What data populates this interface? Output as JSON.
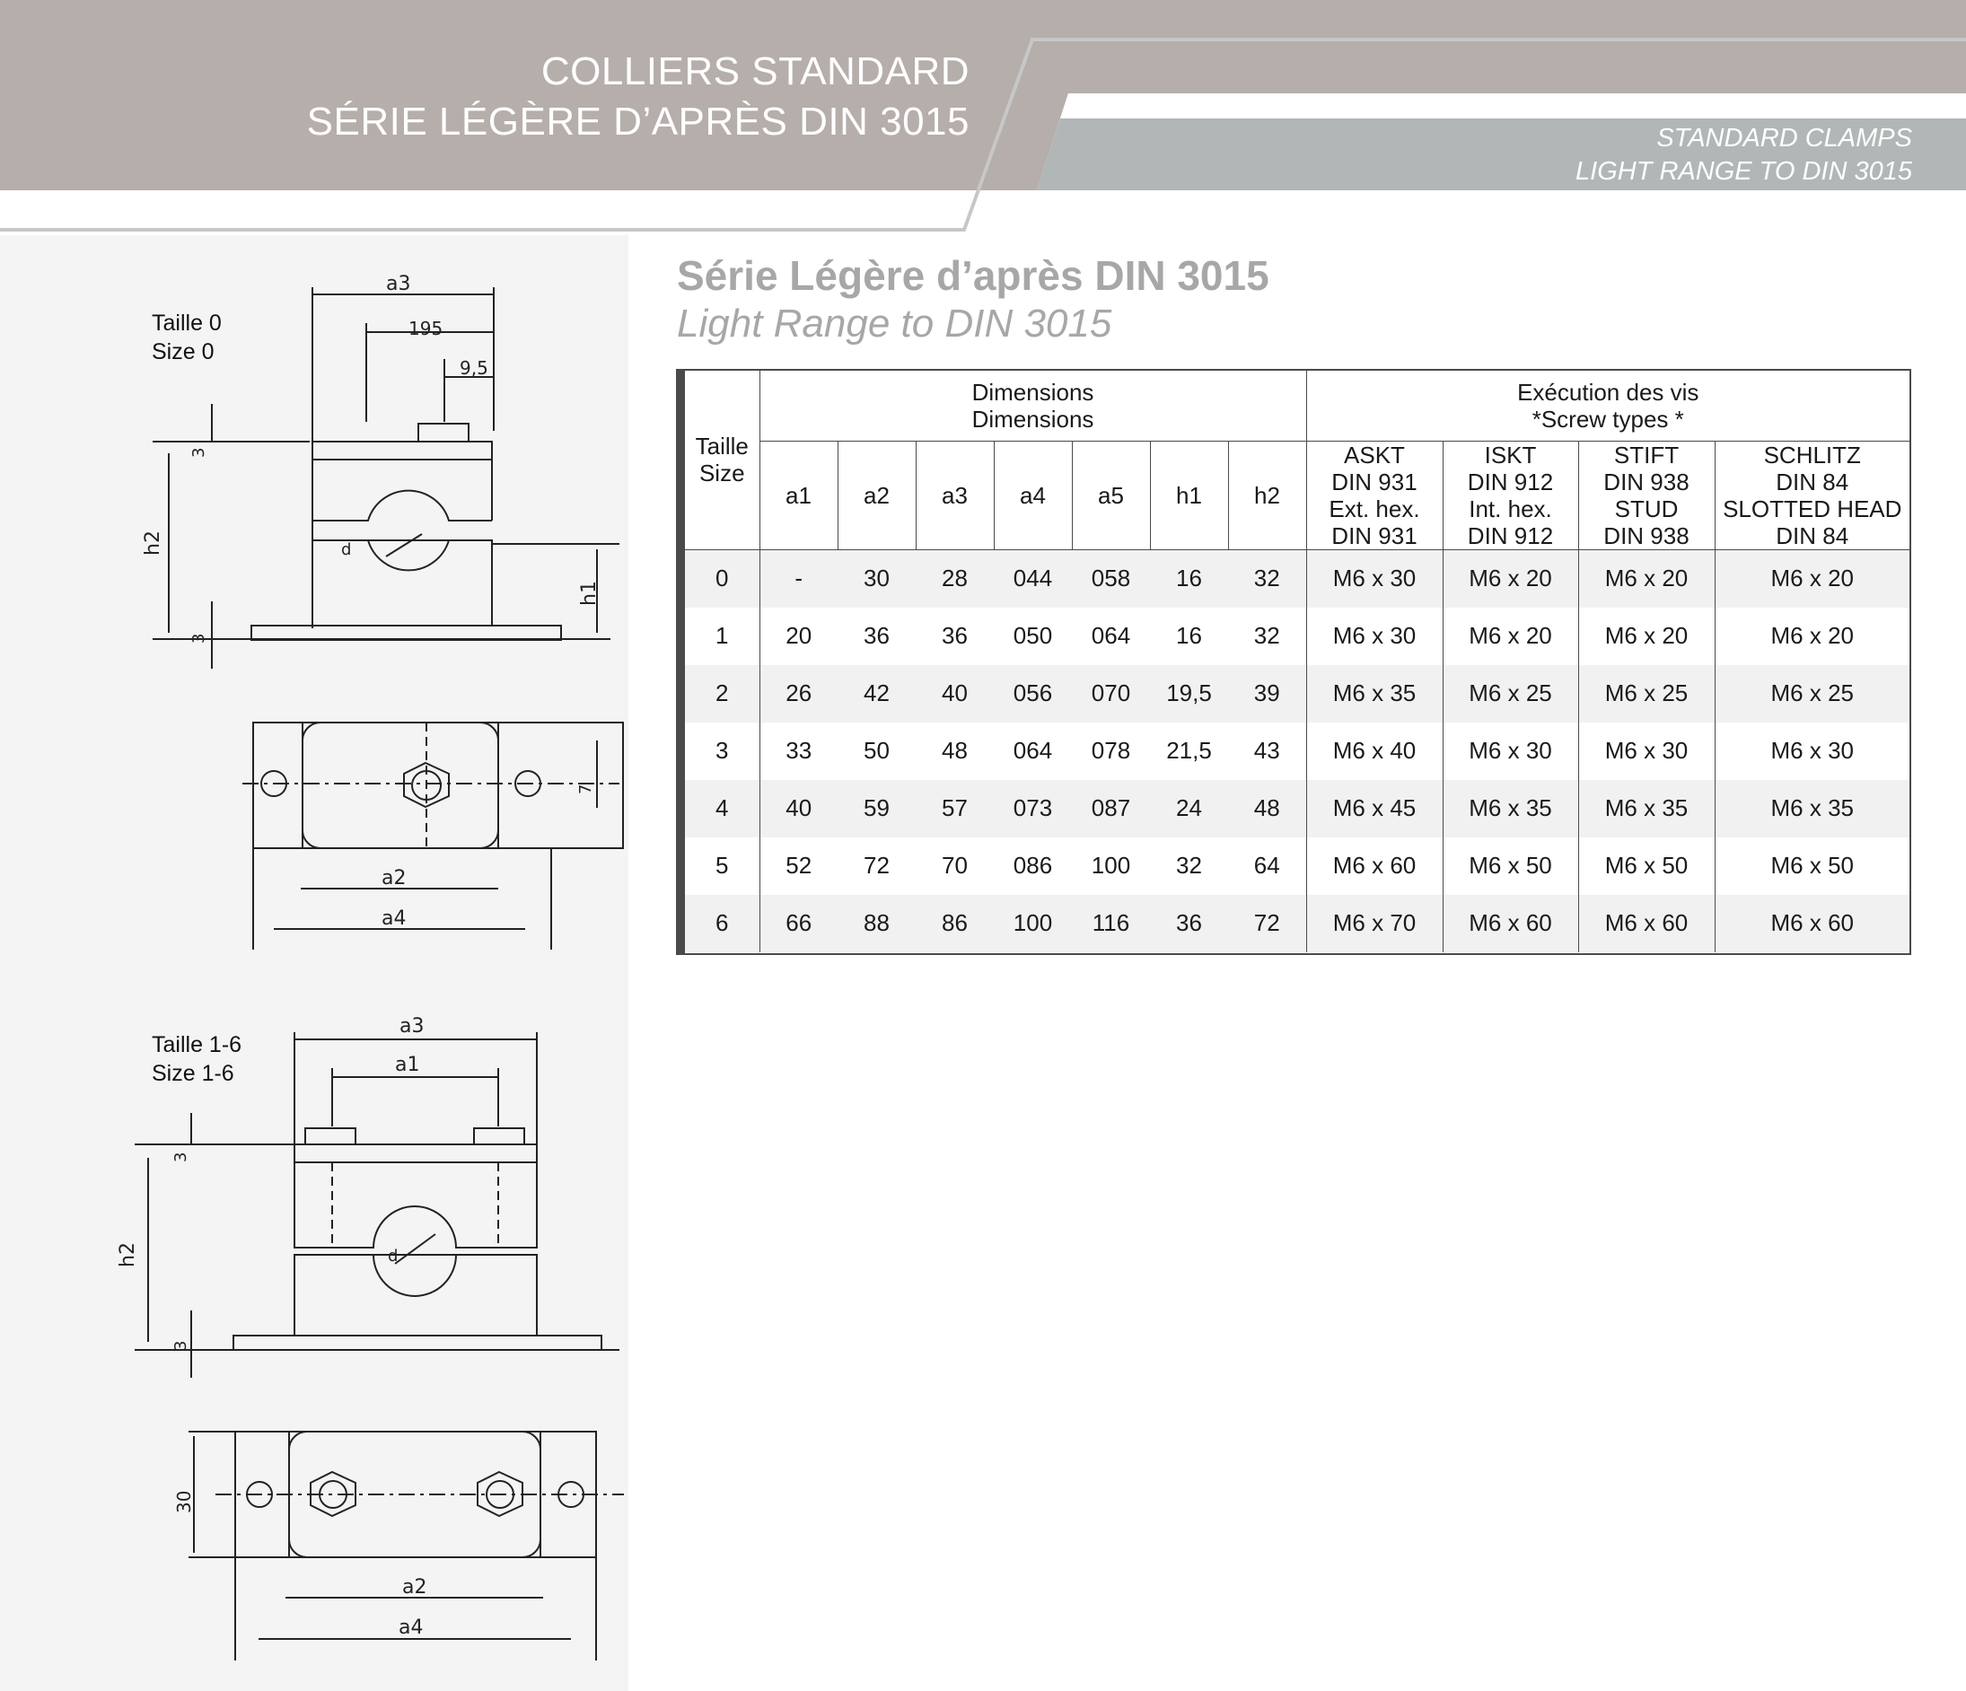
{
  "header": {
    "title_fr_line1": "COLLIERS STANDARD",
    "title_fr_line2": "SÉRIE LÉGÈRE D’APRÈS DIN 3015",
    "title_en_line1": "STANDARD CLAMPS",
    "title_en_line2": "LIGHT RANGE TO DIN 3015",
    "colors": {
      "taupe": "#b5aeaa",
      "grey": "#b1b7b7",
      "white": "#ffffff"
    }
  },
  "drawings": {
    "size0": {
      "label_fr": "Taille 0",
      "label_en": "Size 0",
      "dims": {
        "a3": "a3",
        "d195": "195",
        "d95": "9,5",
        "h2": "h2",
        "h1": "h1",
        "t3a": "3",
        "t3b": "3",
        "d": "d",
        "a2": "a2",
        "a4": "a4",
        "d7": "7"
      }
    },
    "size16": {
      "label_fr": "Taille 1-6",
      "label_en": "Size 1-6",
      "dims": {
        "a3": "a3",
        "a1": "a1",
        "h2": "h2",
        "t3a": "3",
        "t3b": "3",
        "d": "d",
        "d30": "30",
        "a2": "a2",
        "a4": "a4"
      }
    }
  },
  "section": {
    "title": "Série Légère d’après DIN 3015",
    "subtitle": "Light Range to DIN 3015"
  },
  "table": {
    "taille_fr": "Taille",
    "taille_en": "Size",
    "dimensions_fr": "Dimensions",
    "dimensions_en": "Dimensions",
    "execution_fr": "Exécution des vis",
    "execution_en": "*Screw types *",
    "dim_cols": [
      "a1",
      "a2",
      "a3",
      "a4",
      "a5",
      "h1",
      "h2"
    ],
    "screw_cols": [
      {
        "l1": "ASKT",
        "l2": "DIN 931",
        "l3": "Ext. hex.",
        "l4": "DIN 931"
      },
      {
        "l1": "ISKT",
        "l2": "DIN 912",
        "l3": "Int. hex.",
        "l4": "DIN 912"
      },
      {
        "l1": "STIFT",
        "l2": "DIN 938",
        "l3": "STUD",
        "l4": "DIN 938"
      },
      {
        "l1": "SCHLITZ",
        "l2": "DIN 84",
        "l3": "SLOTTED HEAD",
        "l4": "DIN 84"
      }
    ],
    "rows": [
      [
        "0",
        "-",
        "30",
        "28",
        "044",
        "058",
        "16",
        "32",
        "M6 x 30",
        "M6 x 20",
        "M6 x 20",
        "M6 x 20"
      ],
      [
        "1",
        "20",
        "36",
        "36",
        "050",
        "064",
        "16",
        "32",
        "M6 x 30",
        "M6 x 20",
        "M6 x 20",
        "M6 x 20"
      ],
      [
        "2",
        "26",
        "42",
        "40",
        "056",
        "070",
        "19,5",
        "39",
        "M6 x 35",
        "M6 x 25",
        "M6 x 25",
        "M6 x 25"
      ],
      [
        "3",
        "33",
        "50",
        "48",
        "064",
        "078",
        "21,5",
        "43",
        "M6 x 40",
        "M6 x 30",
        "M6 x 30",
        "M6 x 30"
      ],
      [
        "4",
        "40",
        "59",
        "57",
        "073",
        "087",
        "24",
        "48",
        "M6 x 45",
        "M6 x 35",
        "M6 x 35",
        "M6 x 35"
      ],
      [
        "5",
        "52",
        "72",
        "70",
        "086",
        "100",
        "32",
        "64",
        "M6 x 60",
        "M6 x 50",
        "M6 x 50",
        "M6 x 50"
      ],
      [
        "6",
        "66",
        "88",
        "86",
        "100",
        "116",
        "36",
        "72",
        "M6 x 70",
        "M6 x 60",
        "M6 x 60",
        "M6 x 60"
      ]
    ]
  }
}
